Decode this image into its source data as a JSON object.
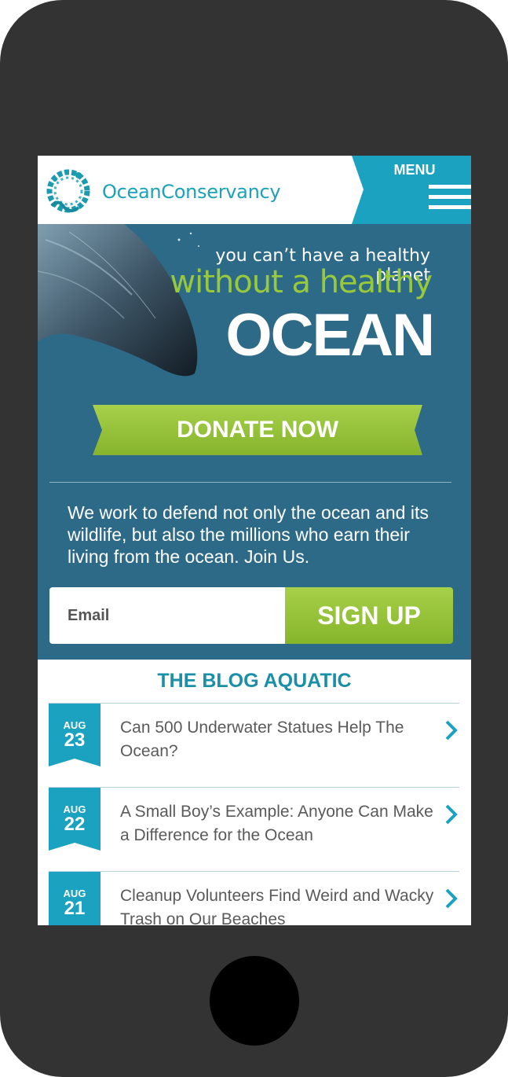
{
  "header": {
    "logo_text": "OceanConservancy",
    "menu_label": "MENU"
  },
  "hero": {
    "line1": "you can’t have a healthy planet",
    "line2": "without a healthy",
    "line3": "OCEAN",
    "donate_label": "DONATE NOW",
    "mission_text": "We work to defend not only the ocean and its wildlife, but also the millions who earn their living from the ocean. Join Us."
  },
  "signup": {
    "email_placeholder": "Email",
    "button_label": "SIGN UP"
  },
  "blog": {
    "title": "THE BLOG AQUATIC",
    "posts": [
      {
        "month": "AUG",
        "day": "23",
        "title": "Can 500 Underwater Statues Help The Ocean?"
      },
      {
        "month": "AUG",
        "day": "22",
        "title": "A Small Boy’s Example: Anyone Can Make a Difference for the Ocean"
      },
      {
        "month": "AUG",
        "day": "21",
        "title": "Cleanup Volunteers Find Weird and Wacky Trash on Our Beaches"
      }
    ]
  },
  "colors": {
    "teal": "#1aa2b8",
    "hero_blue": "#2d6a88",
    "green": "#98c93c",
    "phone_body": "#333333"
  }
}
